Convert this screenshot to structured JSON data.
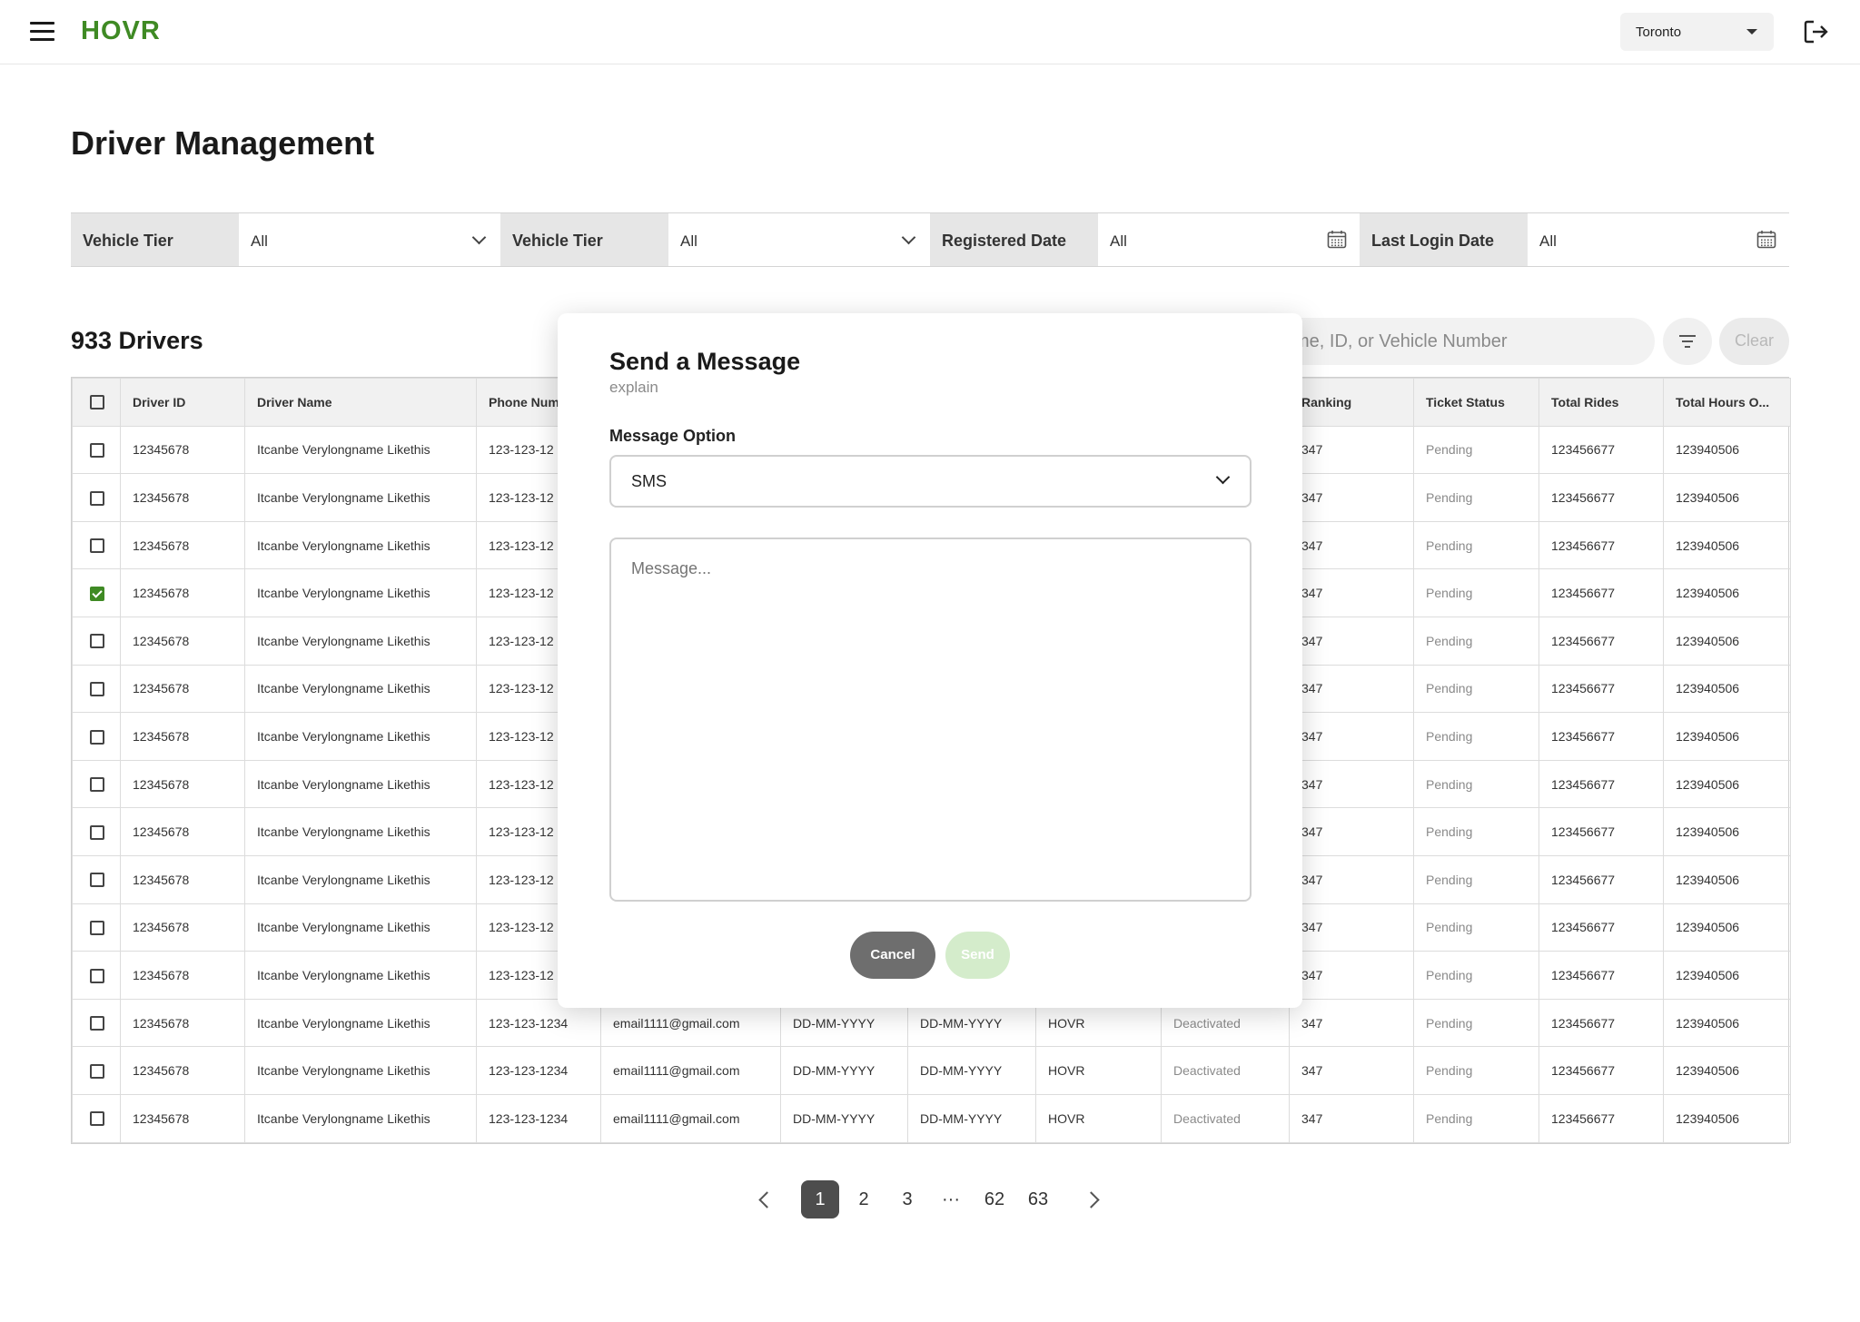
{
  "header": {
    "logo": "HOVR",
    "city": "Toronto"
  },
  "page_title": "Driver Management",
  "filters": [
    {
      "label": "Vehicle Tier",
      "value": "All",
      "kind": "select"
    },
    {
      "label": "Vehicle Tier",
      "value": "All",
      "kind": "select"
    },
    {
      "label": "Registered Date",
      "value": "All",
      "kind": "date"
    },
    {
      "label": "Last Login Date",
      "value": "All",
      "kind": "date"
    }
  ],
  "driver_count": "933 Drivers",
  "search": {
    "visible_text": "me, ID, or Vehicle Number"
  },
  "clear_label": "Clear",
  "table": {
    "columns": [
      "",
      "Driver ID",
      "Driver Name",
      "Phone Num",
      "",
      "",
      "",
      "",
      "",
      "Ranking",
      "Ticket Status",
      "Total Rides",
      "Total Hours O..."
    ],
    "rows_hidden_partial": [
      {
        "id": "12345678",
        "name": "Itcanbe Verylongname Likethis",
        "phone": "123-123-12",
        "ranking": "347",
        "ticket": "Pending",
        "rides": "123456677",
        "hours": "123940506",
        "checked": false
      },
      {
        "id": "12345678",
        "name": "Itcanbe Verylongname Likethis",
        "phone": "123-123-12",
        "ranking": "347",
        "ticket": "Pending",
        "rides": "123456677",
        "hours": "123940506",
        "checked": false
      },
      {
        "id": "12345678",
        "name": "Itcanbe Verylongname Likethis",
        "phone": "123-123-12",
        "ranking": "347",
        "ticket": "Pending",
        "rides": "123456677",
        "hours": "123940506",
        "checked": false
      },
      {
        "id": "12345678",
        "name": "Itcanbe Verylongname Likethis",
        "phone": "123-123-12",
        "ranking": "347",
        "ticket": "Pending",
        "rides": "123456677",
        "hours": "123940506",
        "checked": true
      },
      {
        "id": "12345678",
        "name": "Itcanbe Verylongname Likethis",
        "phone": "123-123-12",
        "ranking": "347",
        "ticket": "Pending",
        "rides": "123456677",
        "hours": "123940506",
        "checked": false
      },
      {
        "id": "12345678",
        "name": "Itcanbe Verylongname Likethis",
        "phone": "123-123-12",
        "ranking": "347",
        "ticket": "Pending",
        "rides": "123456677",
        "hours": "123940506",
        "checked": false
      },
      {
        "id": "12345678",
        "name": "Itcanbe Verylongname Likethis",
        "phone": "123-123-12",
        "ranking": "347",
        "ticket": "Pending",
        "rides": "123456677",
        "hours": "123940506",
        "checked": false
      },
      {
        "id": "12345678",
        "name": "Itcanbe Verylongname Likethis",
        "phone": "123-123-12",
        "ranking": "347",
        "ticket": "Pending",
        "rides": "123456677",
        "hours": "123940506",
        "checked": false
      },
      {
        "id": "12345678",
        "name": "Itcanbe Verylongname Likethis",
        "phone": "123-123-12",
        "ranking": "347",
        "ticket": "Pending",
        "rides": "123456677",
        "hours": "123940506",
        "checked": false
      },
      {
        "id": "12345678",
        "name": "Itcanbe Verylongname Likethis",
        "phone": "123-123-12",
        "ranking": "347",
        "ticket": "Pending",
        "rides": "123456677",
        "hours": "123940506",
        "checked": false
      },
      {
        "id": "12345678",
        "name": "Itcanbe Verylongname Likethis",
        "phone": "123-123-12",
        "ranking": "347",
        "ticket": "Pending",
        "rides": "123456677",
        "hours": "123940506",
        "checked": false
      },
      {
        "id": "12345678",
        "name": "Itcanbe Verylongname Likethis",
        "phone": "123-123-12",
        "ranking": "347",
        "ticket": "Pending",
        "rides": "123456677",
        "hours": "123940506",
        "checked": false
      }
    ],
    "rows_full": [
      {
        "id": "12345678",
        "name": "Itcanbe Verylongname Likethis",
        "phone": "123-123-1234",
        "email": "email1111@gmail.com",
        "date1": "DD-MM-YYYY",
        "date2": "DD-MM-YYYY",
        "company": "HOVR",
        "status": "Deactivated",
        "ranking": "347",
        "ticket": "Pending",
        "rides": "123456677",
        "hours": "123940506",
        "checked": false
      },
      {
        "id": "12345678",
        "name": "Itcanbe Verylongname Likethis",
        "phone": "123-123-1234",
        "email": "email1111@gmail.com",
        "date1": "DD-MM-YYYY",
        "date2": "DD-MM-YYYY",
        "company": "HOVR",
        "status": "Deactivated",
        "ranking": "347",
        "ticket": "Pending",
        "rides": "123456677",
        "hours": "123940506",
        "checked": false
      },
      {
        "id": "12345678",
        "name": "Itcanbe Verylongname Likethis",
        "phone": "123-123-1234",
        "email": "email1111@gmail.com",
        "date1": "DD-MM-YYYY",
        "date2": "DD-MM-YYYY",
        "company": "HOVR",
        "status": "Deactivated",
        "ranking": "347",
        "ticket": "Pending",
        "rides": "123456677",
        "hours": "123940506",
        "checked": false
      }
    ]
  },
  "pagination": {
    "pages": [
      "1",
      "2",
      "3",
      "···",
      "62",
      "63"
    ],
    "active": "1"
  },
  "modal": {
    "title": "Send a Message",
    "subtitle": "explain",
    "option_label": "Message Option",
    "option_value": "SMS",
    "message_placeholder": "Message...",
    "cancel_label": "Cancel",
    "send_label": "Send"
  },
  "colors": {
    "brand_green": "#3f8a24",
    "send_disabled": "#d4eccb",
    "cancel_gray": "#6e6e6e"
  }
}
